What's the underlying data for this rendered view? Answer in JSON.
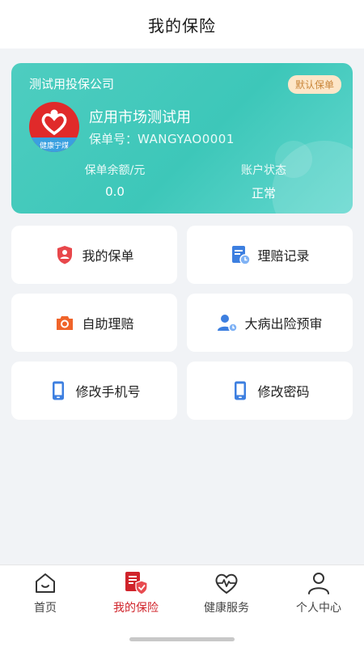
{
  "header": {
    "title": "我的保险"
  },
  "policy_card": {
    "company": "测试用投保公司",
    "default_badge": "默认保单",
    "logo_text": "健康宁煤",
    "product_name": "应用市场测试用",
    "policy_no_label": "保单号：",
    "policy_no": "WANGYAO0001",
    "balance_label": "保单余额/元",
    "balance_value": "0.0",
    "status_label": "账户状态",
    "status_value": "正常",
    "colors": {
      "card": "#3dc7b9",
      "badge_bg": "#fde6c8",
      "badge_text": "#c9863a"
    }
  },
  "tiles": [
    {
      "label": "我的保单",
      "icon": "policy-shield-icon"
    },
    {
      "label": "理赔记录",
      "icon": "claim-record-icon"
    },
    {
      "label": "自助理赔",
      "icon": "camera-icon"
    },
    {
      "label": "大病出险预审",
      "icon": "user-clock-icon"
    },
    {
      "label": "修改手机号",
      "icon": "phone-icon"
    },
    {
      "label": "修改密码",
      "icon": "phone-lock-icon"
    }
  ],
  "tabbar": {
    "items": [
      {
        "label": "首页",
        "icon": "home-icon",
        "active": false
      },
      {
        "label": "我的保险",
        "icon": "insurance-icon",
        "active": true
      },
      {
        "label": "健康服务",
        "icon": "heart-pulse-icon",
        "active": false
      },
      {
        "label": "个人中心",
        "icon": "person-icon",
        "active": false
      }
    ],
    "active_color": "#d0242b"
  }
}
